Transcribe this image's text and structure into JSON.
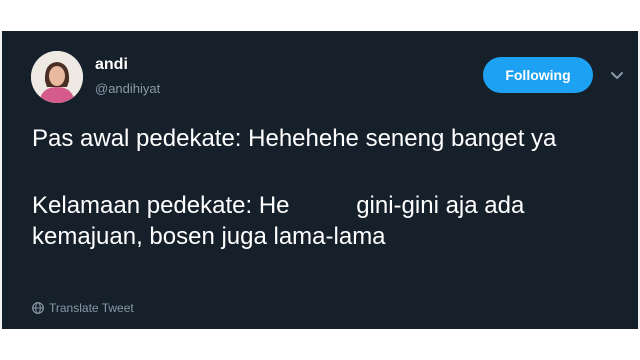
{
  "user": {
    "display_name": "andi",
    "handle": "@andihiyat"
  },
  "follow_button": {
    "label": "Following",
    "color": "#1da1f2"
  },
  "tweet": {
    "line_1": "Pas awal pedekate: Hehehehe seneng banget ya",
    "line_2": "Kelamaan pedekate: He          gini-gini aja ada kemajuan, bosen juga lama-lama"
  },
  "translate": {
    "label": "Translate Tweet",
    "icon": "globe-icon"
  },
  "colors": {
    "card_background": "#15202b",
    "secondary_text": "#8899a6"
  }
}
